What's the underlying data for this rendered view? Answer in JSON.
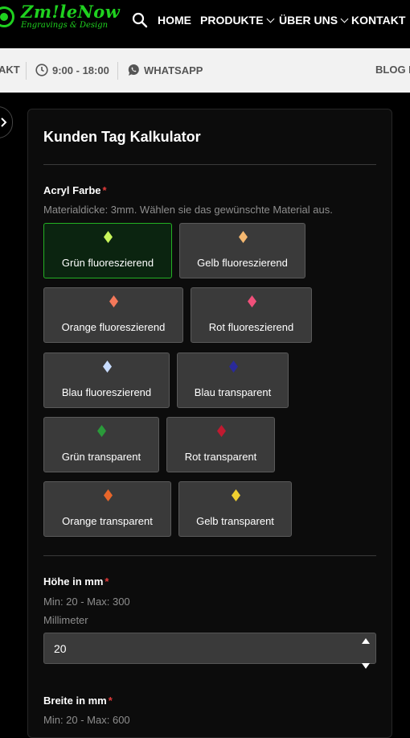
{
  "nav": {
    "logo_name": "Zm!leNow",
    "logo_tagline": "Engravings & Design",
    "search_icon": "search-icon",
    "items": [
      "HOME",
      "PRODUKTE",
      "ÜBER UNS",
      "KONTAKT"
    ]
  },
  "infobar": {
    "contact_partial": "AKT",
    "hours": "9:00 - 18:00",
    "whatsapp": "WHATSAPP",
    "blog_partial": "BLOG F"
  },
  "form": {
    "title": "Kunden Tag Kalkulator",
    "color_field": {
      "label": "Acryl Farbe",
      "required_mark": "*",
      "description": "Materialdicke: 3mm. Wählen sie das gewünschte Material aus.",
      "options": [
        {
          "label": "Grün fluoreszierend",
          "gem_color": "#c8f55a",
          "selected": true
        },
        {
          "label": "Gelb fluoreszierend",
          "gem_color": "#f5b870"
        },
        {
          "label": "Orange fluoreszierend",
          "gem_color": "#f4785a"
        },
        {
          "label": "Rot fluoreszierend",
          "gem_color": "#f0507a"
        },
        {
          "label": "Blau fluoreszierend",
          "gem_color": "#c8dcff"
        },
        {
          "label": "Blau transparent",
          "gem_color": "#2a2a9a"
        },
        {
          "label": "Grün transparent",
          "gem_color": "#2a9a3a"
        },
        {
          "label": "Rot transparent",
          "gem_color": "#c01a30"
        },
        {
          "label": "Orange transparent",
          "gem_color": "#e8662a"
        },
        {
          "label": "Gelb transparent",
          "gem_color": "#f0d030"
        }
      ]
    },
    "height_field": {
      "label": "Höhe in mm",
      "required_mark": "*",
      "range": "Min: 20 - Max: 300",
      "unit": "Millimeter",
      "value": "20"
    },
    "width_field": {
      "label": "Breite in mm",
      "required_mark": "*",
      "range": "Min: 20 - Max: 600"
    }
  }
}
